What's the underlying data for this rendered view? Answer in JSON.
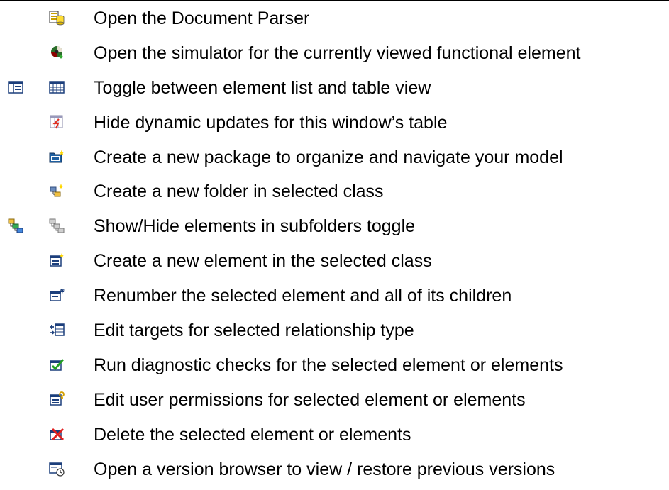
{
  "toolbar_help": {
    "items": [
      {
        "icon": "document-parser-icon",
        "text": "Open the Document Parser"
      },
      {
        "icon": "simulator-icon",
        "text": "Open the simulator for the currently viewed functional element"
      },
      {
        "icon": "table-view-icon",
        "alt_icon": "list-view-icon",
        "text": "Toggle between element list and table view"
      },
      {
        "icon": "hide-dynamic-updates-icon",
        "text": "Hide dynamic updates for this window’s table"
      },
      {
        "icon": "new-package-icon",
        "text": "Create a new package to organize and navigate your model"
      },
      {
        "icon": "new-folder-icon",
        "text": "Create a new folder in selected class"
      },
      {
        "icon": "subfolders-hidden-icon",
        "alt_icon": "subfolders-shown-icon",
        "text": "Show/Hide elements in subfolders toggle"
      },
      {
        "icon": "new-element-icon",
        "text": "Create a new element in the selected class"
      },
      {
        "icon": "renumber-icon",
        "text": "Renumber the selected element and all of its children"
      },
      {
        "icon": "edit-targets-icon",
        "text": "Edit targets for selected relationship type"
      },
      {
        "icon": "diagnostic-check-icon",
        "text": "Run diagnostic checks for the selected element or elements"
      },
      {
        "icon": "user-permissions-icon",
        "text": "Edit user permissions for selected element or elements"
      },
      {
        "icon": "delete-element-icon",
        "text": "Delete the selected element or elements"
      },
      {
        "icon": "version-browser-icon",
        "text": "Open a version browser to view / restore previous versions"
      }
    ]
  }
}
